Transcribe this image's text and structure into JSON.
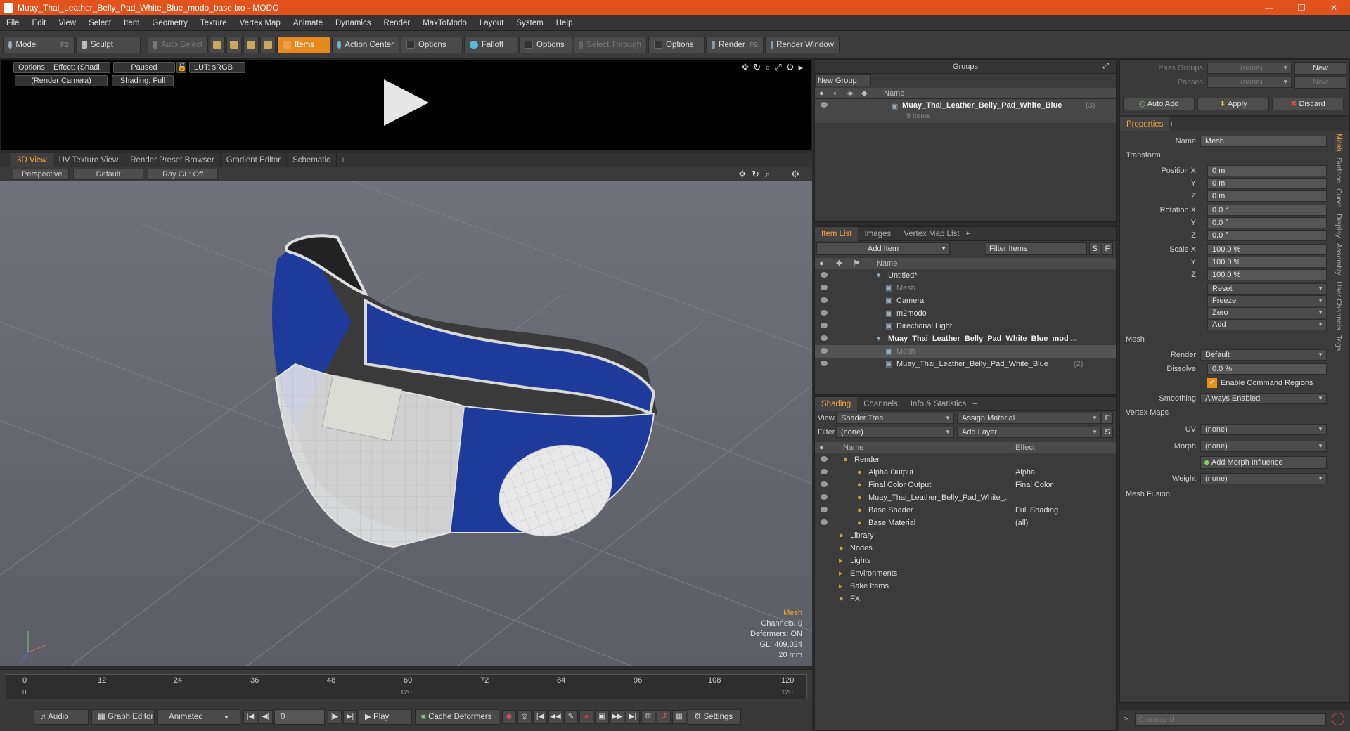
{
  "window": {
    "title": "Muay_Thai_Leather_Belly_Pad_White_Blue_modo_base.lxo - MODO",
    "controls": [
      "—",
      "❐",
      "✕"
    ]
  },
  "menu": [
    "File",
    "Edit",
    "View",
    "Select",
    "Item",
    "Geometry",
    "Texture",
    "Vertex Map",
    "Animate",
    "Dynamics",
    "Render",
    "MaxToModo",
    "Layout",
    "System",
    "Help"
  ],
  "toolbar": {
    "model": "Model",
    "model_key": "F2",
    "sculpt": "Sculpt",
    "auto_select": "Auto Select",
    "items": "Items",
    "action_center": "Action Center",
    "options1": "Options",
    "falloff": "Falloff",
    "options2": "Options",
    "select_through": "Select Through",
    "options3": "Options",
    "render": "Render",
    "render_key": "F9",
    "render_window": "Render Window"
  },
  "preview": {
    "options": "Options",
    "effect": "Effect: (Shadi...",
    "paused": "Paused",
    "lut": "LUT: sRGB",
    "camera": "(Render Camera)",
    "shading": "Shading: Full"
  },
  "viewport_tabs": [
    "3D View",
    "UV Texture View",
    "Render Preset Browser",
    "Gradient Editor",
    "Schematic"
  ],
  "viewport_opts": {
    "view": "Perspective",
    "style": "Default",
    "raygl": "Ray GL: Off"
  },
  "viewport_info": {
    "item": "Mesh",
    "channels": "Channels: 0",
    "deformers": "Deformers: ON",
    "gl": "GL: 409,024",
    "size": "20 mm"
  },
  "timeline": {
    "ticks": [
      "0",
      "12",
      "24",
      "36",
      "48",
      "60",
      "72",
      "84",
      "96",
      "108",
      "120"
    ],
    "sub_mid": "120",
    "sub_end": "120"
  },
  "bottom": {
    "audio": "Audio",
    "graph_editor": "Graph Editor",
    "animated": "Animated",
    "frame": "0",
    "play": "Play",
    "cache": "Cache Deformers",
    "settings": "Settings"
  },
  "groups": {
    "title": "Groups",
    "new_group": "New Group",
    "col_name": "Name",
    "item_name": "Muay_Thai_Leather_Belly_Pad_White_Blue",
    "item_count": "(3)",
    "item_sub": "9 Items"
  },
  "itemlist": {
    "tabs": [
      "Item List",
      "Images",
      "Vertex Map List"
    ],
    "add_item": "Add Item",
    "filter": "Filter Items",
    "col_name": "Name",
    "rows": [
      {
        "label": "Untitled*",
        "indent": 0
      },
      {
        "label": "Mesh",
        "indent": 1,
        "dim": true
      },
      {
        "label": "Camera",
        "indent": 1
      },
      {
        "label": "m2modo",
        "indent": 1
      },
      {
        "label": "Directional Light",
        "indent": 1
      },
      {
        "label": "Muay_Thai_Leather_Belly_Pad_White_Blue_mod ...",
        "indent": 0,
        "bold": true
      },
      {
        "label": "Mesh",
        "indent": 1,
        "dim": true,
        "sel": true
      },
      {
        "label": "Muay_Thai_Leather_Belly_Pad_White_Blue",
        "indent": 1,
        "suffix": "(2)"
      }
    ]
  },
  "shading": {
    "tabs": [
      "Shading",
      "Channels",
      "Info & Statistics"
    ],
    "view_lbl": "View",
    "view_val": "Shader Tree",
    "assign": "Assign Material",
    "filter_lbl": "Filter",
    "filter_val": "(none)",
    "add_layer": "Add Layer",
    "col_name": "Name",
    "col_effect": "Effect",
    "rows": [
      {
        "name": "Render",
        "effect": "",
        "indent": 0
      },
      {
        "name": "Alpha Output",
        "effect": "Alpha",
        "indent": 1
      },
      {
        "name": "Final Color Output",
        "effect": "Final Color",
        "indent": 1
      },
      {
        "name": "Muay_Thai_Leather_Belly_Pad_White_...",
        "effect": "",
        "indent": 1
      },
      {
        "name": "Base Shader",
        "effect": "Full Shading",
        "indent": 1
      },
      {
        "name": "Base Material",
        "effect": "(all)",
        "indent": 1
      },
      {
        "name": "Library",
        "effect": "",
        "indent": 2
      },
      {
        "name": "Nodes",
        "effect": "",
        "indent": 2
      },
      {
        "name": "Lights",
        "effect": "",
        "indent": 3
      },
      {
        "name": "Environments",
        "effect": "",
        "indent": 3
      },
      {
        "name": "Bake Items",
        "effect": "",
        "indent": 3
      },
      {
        "name": "FX",
        "effect": "",
        "indent": 2
      }
    ]
  },
  "passes": {
    "pass_groups": "Pass Groups",
    "passes": "Passes",
    "none": "(none)",
    "new": "New",
    "auto_add": "Auto Add",
    "apply": "Apply",
    "discard": "Discard"
  },
  "properties": {
    "tab": "Properties",
    "name_lbl": "Name",
    "name_val": "Mesh",
    "transform": "Transform",
    "pos_x": "Position X",
    "y": "Y",
    "z": "Z",
    "rot_x": "Rotation X",
    "scale_x": "Scale X",
    "pos": [
      "0 m",
      "0 m",
      "0 m"
    ],
    "rot": [
      "0.0 °",
      "0.0 °",
      "0.0 °"
    ],
    "scale": [
      "100.0 %",
      "100.0 %",
      "100.0 %"
    ],
    "reset": "Reset",
    "freeze": "Freeze",
    "zero": "Zero",
    "add": "Add",
    "mesh": "Mesh",
    "render_lbl": "Render",
    "render_val": "Default",
    "dissolve_lbl": "Dissolve",
    "dissolve_val": "0.0 %",
    "ecr": "Enable Command Regions",
    "smoothing_lbl": "Smoothing",
    "smoothing_val": "Always Enabled",
    "vertex_maps": "Vertex Maps",
    "uv_lbl": "UV",
    "uv_val": "(none)",
    "morph_lbl": "Morph",
    "morph_val": "(none)",
    "add_morph": "Add Morph Influence",
    "weight_lbl": "Weight",
    "weight_val": "(none)",
    "mesh_fusion": "Mesh Fusion",
    "side_tabs": [
      "Mesh",
      "Surface",
      "Curve",
      "Display",
      "Assembly",
      "User Channels",
      "Tags"
    ]
  },
  "command": {
    "placeholder": "Command"
  }
}
